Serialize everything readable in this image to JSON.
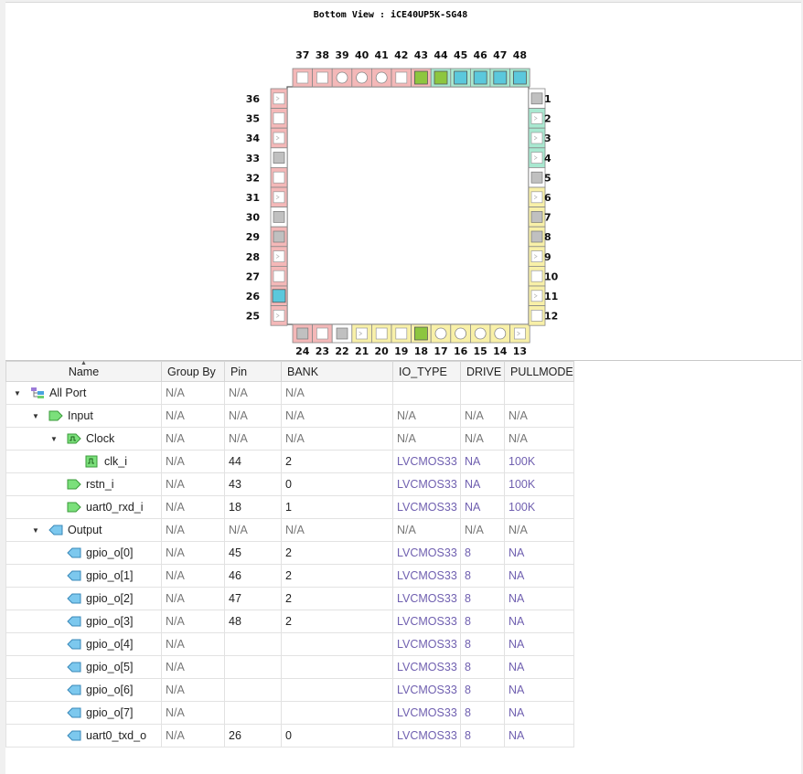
{
  "package": {
    "title": "Bottom View : iCE40UP5K-SG48",
    "colors": {
      "bank0": "#f4b8b8",
      "bank1": "#f8f0a8",
      "bank2": "#a8e8d0",
      "grey": "#c0c0c0",
      "assigned_in": "#8dc63f",
      "assigned_out": "#5bc8dc",
      "outline": "#888888"
    },
    "top": [
      37,
      38,
      39,
      40,
      41,
      42,
      43,
      44,
      45,
      46,
      47,
      48
    ],
    "bottom": [
      24,
      23,
      22,
      21,
      20,
      19,
      18,
      17,
      16,
      15,
      14,
      13
    ],
    "left": [
      36,
      35,
      34,
      33,
      32,
      31,
      30,
      29,
      28,
      27,
      26,
      25
    ],
    "right": [
      1,
      2,
      3,
      4,
      5,
      6,
      7,
      8,
      9,
      10,
      11,
      12
    ],
    "pin_info": {
      "1": {
        "bank": "white",
        "sym": "grey"
      },
      "2": {
        "bank": "bank2",
        "sym": "wave"
      },
      "3": {
        "bank": "bank2",
        "sym": "wave"
      },
      "4": {
        "bank": "bank2",
        "sym": "wave"
      },
      "5": {
        "bank": "white",
        "sym": "grey"
      },
      "6": {
        "bank": "bank1",
        "sym": "wave"
      },
      "7": {
        "bank": "bank1",
        "sym": "grey"
      },
      "8": {
        "bank": "bank1",
        "sym": "grey"
      },
      "9": {
        "bank": "bank1",
        "sym": "wave"
      },
      "10": {
        "bank": "bank1",
        "sym": "sq"
      },
      "11": {
        "bank": "bank1",
        "sym": "wave"
      },
      "12": {
        "bank": "bank1",
        "sym": "sq"
      },
      "13": {
        "bank": "bank1",
        "sym": "wave"
      },
      "14": {
        "bank": "bank1",
        "sym": "circ"
      },
      "15": {
        "bank": "bank1",
        "sym": "circ"
      },
      "16": {
        "bank": "bank1",
        "sym": "circ"
      },
      "17": {
        "bank": "bank1",
        "sym": "circ"
      },
      "18": {
        "bank": "bank1",
        "sym": "in"
      },
      "19": {
        "bank": "bank1",
        "sym": "sq"
      },
      "20": {
        "bank": "bank1",
        "sym": "sq"
      },
      "21": {
        "bank": "bank1",
        "sym": "wave"
      },
      "22": {
        "bank": "white",
        "sym": "grey"
      },
      "23": {
        "bank": "bank0",
        "sym": "sq"
      },
      "24": {
        "bank": "bank0",
        "sym": "grey"
      },
      "25": {
        "bank": "bank0",
        "sym": "wave"
      },
      "26": {
        "bank": "bank0",
        "sym": "out"
      },
      "27": {
        "bank": "bank0",
        "sym": "sq"
      },
      "28": {
        "bank": "bank0",
        "sym": "wave"
      },
      "29": {
        "bank": "bank0",
        "sym": "grey"
      },
      "30": {
        "bank": "white",
        "sym": "grey"
      },
      "31": {
        "bank": "bank0",
        "sym": "wave"
      },
      "32": {
        "bank": "bank0",
        "sym": "sq"
      },
      "33": {
        "bank": "white",
        "sym": "grey"
      },
      "34": {
        "bank": "bank0",
        "sym": "wave"
      },
      "35": {
        "bank": "bank0",
        "sym": "sq"
      },
      "36": {
        "bank": "bank0",
        "sym": "wave"
      },
      "37": {
        "bank": "bank0",
        "sym": "sq"
      },
      "38": {
        "bank": "bank0",
        "sym": "sq"
      },
      "39": {
        "bank": "bank0",
        "sym": "circ"
      },
      "40": {
        "bank": "bank0",
        "sym": "circ"
      },
      "41": {
        "bank": "bank0",
        "sym": "circ"
      },
      "42": {
        "bank": "bank0",
        "sym": "sq"
      },
      "43": {
        "bank": "bank0",
        "sym": "in"
      },
      "44": {
        "bank": "bank2",
        "sym": "in"
      },
      "45": {
        "bank": "bank2",
        "sym": "out"
      },
      "46": {
        "bank": "bank2",
        "sym": "out"
      },
      "47": {
        "bank": "bank2",
        "sym": "out"
      },
      "48": {
        "bank": "bank2",
        "sym": "out"
      }
    }
  },
  "table": {
    "columns": [
      "Name",
      "Group By",
      "Pin",
      "BANK",
      "IO_TYPE",
      "DRIVE",
      "PULLMODE"
    ],
    "rows": [
      {
        "name": "All Port",
        "level": 0,
        "toggle": "down",
        "icon": "group",
        "cells": [
          "N/A",
          "N/A",
          "N/A",
          "",
          "",
          ""
        ]
      },
      {
        "name": "Input",
        "level": 1,
        "toggle": "down",
        "icon": "in",
        "cells": [
          "N/A",
          "N/A",
          "N/A",
          "N/A",
          "N/A",
          "N/A"
        ]
      },
      {
        "name": "Clock",
        "level": 2,
        "toggle": "down",
        "icon": "clock",
        "cells": [
          "N/A",
          "N/A",
          "N/A",
          "N/A",
          "N/A",
          "N/A"
        ]
      },
      {
        "name": "clk_i",
        "level": 3,
        "toggle": "",
        "icon": "clkleaf",
        "cells": [
          "N/A",
          "44",
          "2",
          "LVCMOS33",
          "NA",
          "100K"
        ]
      },
      {
        "name": "rstn_i",
        "level": 2,
        "toggle": "",
        "icon": "in",
        "cells": [
          "N/A",
          "43",
          "0",
          "LVCMOS33",
          "NA",
          "100K"
        ]
      },
      {
        "name": "uart0_rxd_i",
        "level": 2,
        "toggle": "",
        "icon": "in",
        "cells": [
          "N/A",
          "18",
          "1",
          "LVCMOS33",
          "NA",
          "100K"
        ]
      },
      {
        "name": "Output",
        "level": 1,
        "toggle": "down",
        "icon": "out",
        "cells": [
          "N/A",
          "N/A",
          "N/A",
          "N/A",
          "N/A",
          "N/A"
        ]
      },
      {
        "name": "gpio_o[0]",
        "level": 2,
        "toggle": "",
        "icon": "out",
        "cells": [
          "N/A",
          "45",
          "2",
          "LVCMOS33",
          "8",
          "NA"
        ]
      },
      {
        "name": "gpio_o[1]",
        "level": 2,
        "toggle": "",
        "icon": "out",
        "cells": [
          "N/A",
          "46",
          "2",
          "LVCMOS33",
          "8",
          "NA"
        ]
      },
      {
        "name": "gpio_o[2]",
        "level": 2,
        "toggle": "",
        "icon": "out",
        "cells": [
          "N/A",
          "47",
          "2",
          "LVCMOS33",
          "8",
          "NA"
        ]
      },
      {
        "name": "gpio_o[3]",
        "level": 2,
        "toggle": "",
        "icon": "out",
        "cells": [
          "N/A",
          "48",
          "2",
          "LVCMOS33",
          "8",
          "NA"
        ]
      },
      {
        "name": "gpio_o[4]",
        "level": 2,
        "toggle": "",
        "icon": "out",
        "cells": [
          "N/A",
          "",
          "",
          "LVCMOS33",
          "8",
          "NA"
        ]
      },
      {
        "name": "gpio_o[5]",
        "level": 2,
        "toggle": "",
        "icon": "out",
        "cells": [
          "N/A",
          "",
          "",
          "LVCMOS33",
          "8",
          "NA"
        ]
      },
      {
        "name": "gpio_o[6]",
        "level": 2,
        "toggle": "",
        "icon": "out",
        "cells": [
          "N/A",
          "",
          "",
          "LVCMOS33",
          "8",
          "NA"
        ]
      },
      {
        "name": "gpio_o[7]",
        "level": 2,
        "toggle": "",
        "icon": "out",
        "cells": [
          "N/A",
          "",
          "",
          "LVCMOS33",
          "8",
          "NA"
        ]
      },
      {
        "name": "uart0_txd_o",
        "level": 2,
        "toggle": "",
        "icon": "out",
        "cells": [
          "N/A",
          "26",
          "0",
          "LVCMOS33",
          "8",
          "NA"
        ]
      }
    ]
  }
}
